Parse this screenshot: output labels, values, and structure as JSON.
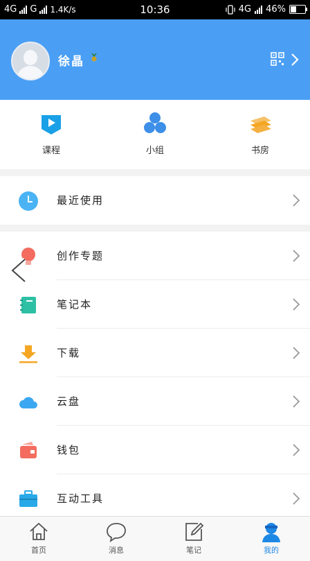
{
  "status_bar": {
    "left_network1": "4G",
    "left_network2": "G",
    "speed": "1.4K/s",
    "time": "10:36",
    "right_network": "4G",
    "battery": "46%",
    "battery_level": 0.46
  },
  "profile": {
    "name": "徐晶",
    "badge_icon": "medal-icon",
    "qr_icon": "qr-code-icon"
  },
  "quick_actions": [
    {
      "label": "课程",
      "icon": "course-play-icon",
      "color": "#1aa0e6"
    },
    {
      "label": "小组",
      "icon": "group-circles-icon",
      "color": "#3d8fe8"
    },
    {
      "label": "书房",
      "icon": "bookshelf-layers-icon",
      "color": "#f5b041"
    }
  ],
  "recent": {
    "label": "最近使用",
    "icon": "clock-icon",
    "color": "#4ab3f4"
  },
  "menu": [
    {
      "label": "创作专题",
      "icon": "lightbulb-icon",
      "color": "#f36c5f"
    },
    {
      "label": "笔记本",
      "icon": "notebook-icon",
      "color": "#2dc0a5"
    },
    {
      "label": "下载",
      "icon": "download-icon",
      "color": "#f5a623"
    },
    {
      "label": "云盘",
      "icon": "cloud-icon",
      "color": "#3ba7f0"
    },
    {
      "label": "钱包",
      "icon": "wallet-icon",
      "color": "#f36c5f"
    },
    {
      "label": "互动工具",
      "icon": "toolbox-icon",
      "color": "#29a9e8"
    }
  ],
  "tabs": [
    {
      "label": "首页",
      "icon": "home-icon"
    },
    {
      "label": "消息",
      "icon": "message-bubble-icon"
    },
    {
      "label": "笔记",
      "icon": "note-edit-icon"
    },
    {
      "label": "我的",
      "icon": "profile-avatar-icon",
      "active": true
    }
  ],
  "colors": {
    "header": "#4a9ff5",
    "active_tab": "#1e88e5"
  }
}
